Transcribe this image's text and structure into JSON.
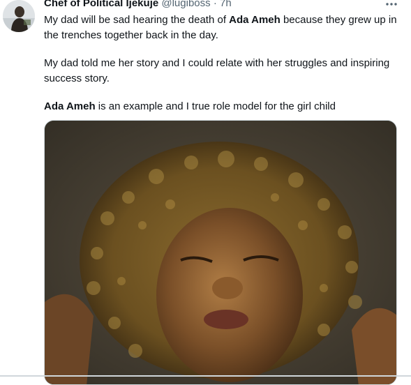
{
  "tweet": {
    "display_name": "Chef of Political Ijekuje",
    "handle": "@lugiboss",
    "separator": "·",
    "time": "7h",
    "paragraph1": {
      "part1": "My dad will be sad hearing the death of ",
      "bold": "Ada Ameh",
      "part2": " because they grew up in the trenches together back in the day."
    },
    "paragraph2": "My dad told me her story and I could relate with her struggles and inspiring success story.",
    "paragraph3": {
      "bold": "Ada Ameh",
      "rest": " is an example and I true role model for the girl child"
    },
    "more_icon": "more-horizontal-icon",
    "media": {
      "description_icon": "photo"
    }
  },
  "colors": {
    "text": "#0f1419",
    "secondary": "#536471",
    "border": "#cfd9de"
  }
}
